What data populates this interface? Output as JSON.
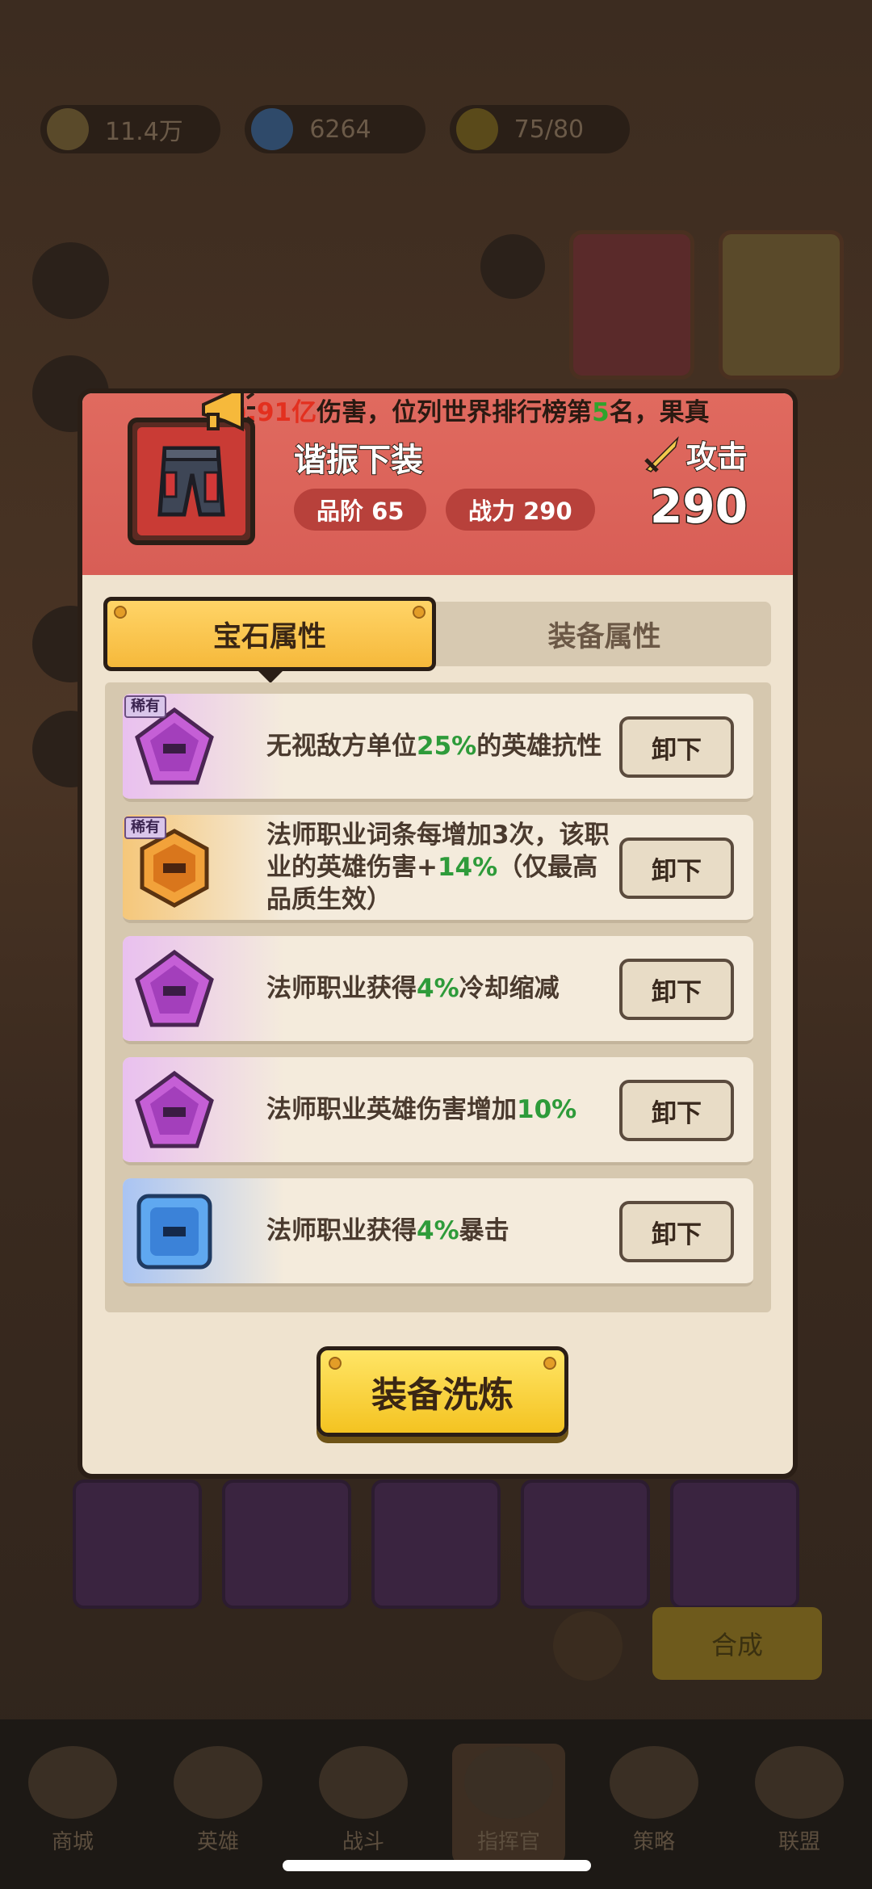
{
  "background": {
    "resources": [
      "11.4万",
      "6264",
      "75/80"
    ],
    "nav_items": [
      "商城",
      "英雄",
      "战斗",
      "指挥官",
      "策略",
      "联盟"
    ],
    "merge_label": "合成"
  },
  "broadcast": {
    "text_red": ").91亿",
    "text_main": "伤害，位列世界排行榜第",
    "rank": "5",
    "text_tail": "名，果真"
  },
  "item": {
    "name": "谐振下装",
    "type_label": "攻击",
    "grade_label": "品阶 65",
    "power_label": "战力 290",
    "power_value": "290"
  },
  "tabs": {
    "gem_attr": "宝石属性",
    "equip_attr": "装备属性"
  },
  "gems": [
    {
      "rarity": "稀有",
      "color": "purple",
      "shape": "pentagon",
      "pre": "无视敌方单位",
      "value": "25%",
      "post": "的英雄抗性",
      "button": "卸下"
    },
    {
      "rarity": "稀有",
      "color": "orange",
      "shape": "hexagon",
      "pre": "法师职业词条每增加3次，该职业的英雄伤害+",
      "value": "14%",
      "post": "（仅最高品质生效）",
      "button": "卸下"
    },
    {
      "rarity": "",
      "color": "purple",
      "shape": "pentagon",
      "pre": "法师职业获得",
      "value": "4%",
      "post": "冷却缩减",
      "button": "卸下"
    },
    {
      "rarity": "",
      "color": "purple",
      "shape": "pentagon",
      "pre": "法师职业英雄伤害增加",
      "value": "10%",
      "post": "",
      "button": "卸下"
    },
    {
      "rarity": "",
      "color": "blue",
      "shape": "square",
      "pre": "法师职业获得",
      "value": "4%",
      "post": "暴击",
      "button": "卸下"
    }
  ],
  "refine_button": "装备洗炼",
  "colors": {
    "header_red": "#d85e56",
    "tab_gold": "#f6b93b",
    "value_green": "#2e9b3a",
    "button_yellow": "#f4c321"
  }
}
